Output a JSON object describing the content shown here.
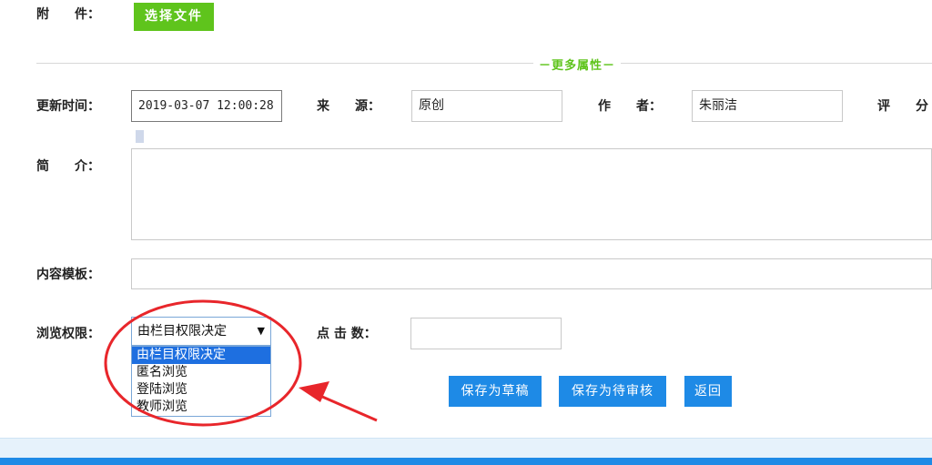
{
  "attachment": {
    "label": "附　　件：",
    "button": "选择文件"
  },
  "section": {
    "title": "－更多属性－"
  },
  "update_time": {
    "label": "更新时间：",
    "value": "2019-03-07 12:00:28"
  },
  "source": {
    "label": "来　　源：",
    "value": "原创"
  },
  "author": {
    "label": "作　　者：",
    "value": "朱丽洁"
  },
  "rating": {
    "label": "评　　分"
  },
  "intro": {
    "label": "简　　介：",
    "value": ""
  },
  "template": {
    "label": "内容模板：",
    "value": ""
  },
  "permission": {
    "label": "浏览权限：",
    "selected": "由栏目权限决定",
    "options": [
      "由栏目权限决定",
      "匿名浏览",
      "登陆浏览",
      "教师浏览"
    ]
  },
  "clicks": {
    "label": "点 击 数：",
    "value": ""
  },
  "actions": {
    "save_draft": "保存为草稿",
    "save_review": "保存为待审核",
    "back": "返回"
  },
  "annotation": {
    "color": "#e8262b"
  },
  "colors": {
    "green": "#5fc41c",
    "blue": "#1e8ae6",
    "selected": "#1e6fe0"
  }
}
